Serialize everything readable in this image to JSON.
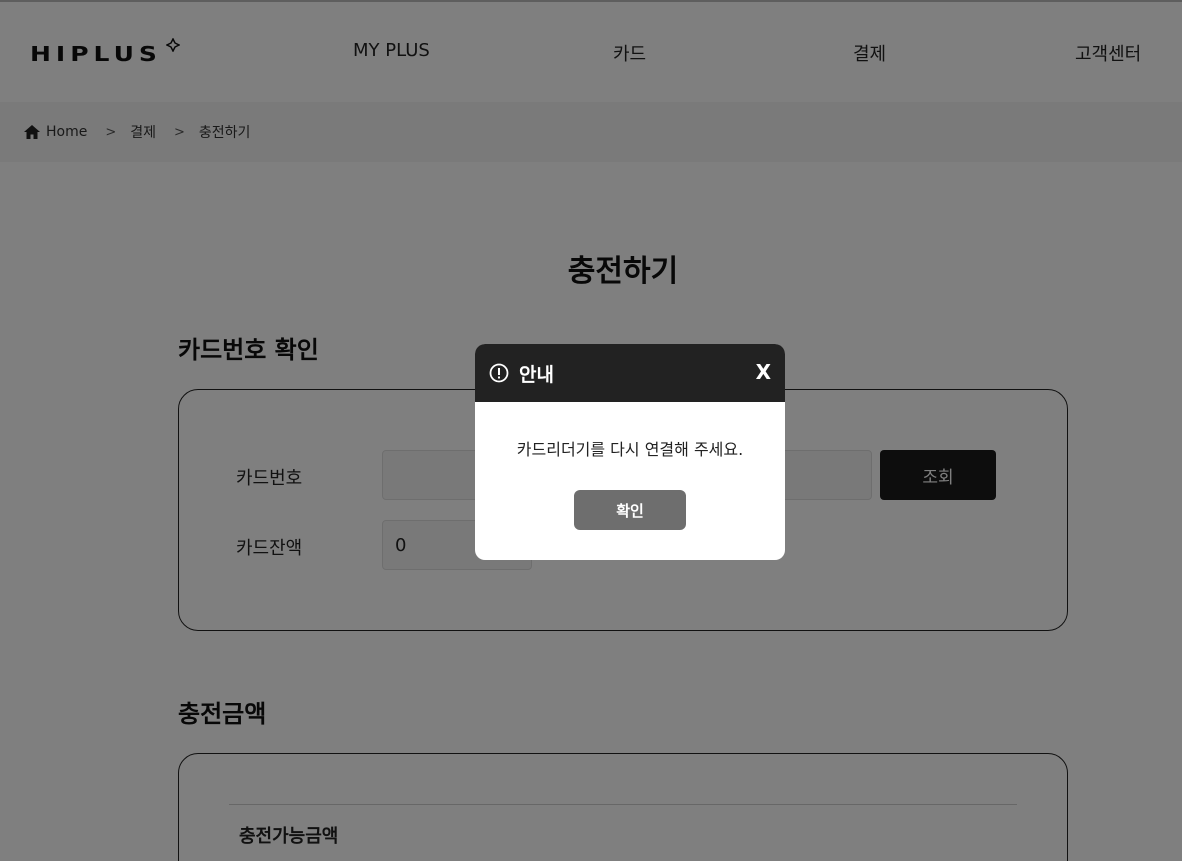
{
  "header": {
    "logo": "HIPLUS",
    "nav": [
      "MY PLUS",
      "카드",
      "결제",
      "고객센터"
    ]
  },
  "breadcrumb": {
    "home": "Home",
    "level1": "결제",
    "level2": "충전하기",
    "separator": ">"
  },
  "page": {
    "title": "충전하기"
  },
  "card_section": {
    "title": "카드번호 확인",
    "card_number_label": "카드번호",
    "card_number_value": "",
    "search_button": "조회",
    "balance_label": "카드잔액",
    "balance_value": "0"
  },
  "amount_section": {
    "title": "충전금액",
    "available_label": "충전가능금액"
  },
  "modal": {
    "title": "안내",
    "close_label": "X",
    "message": "카드리더기를 다시 연결해 주세요.",
    "ok_label": "확인"
  },
  "colors": {
    "modal_header": "#222222",
    "ok_button": "#6e6e6e",
    "search_button": "#1a1a1a",
    "overlay": "rgba(0,0,0,0.5)"
  }
}
